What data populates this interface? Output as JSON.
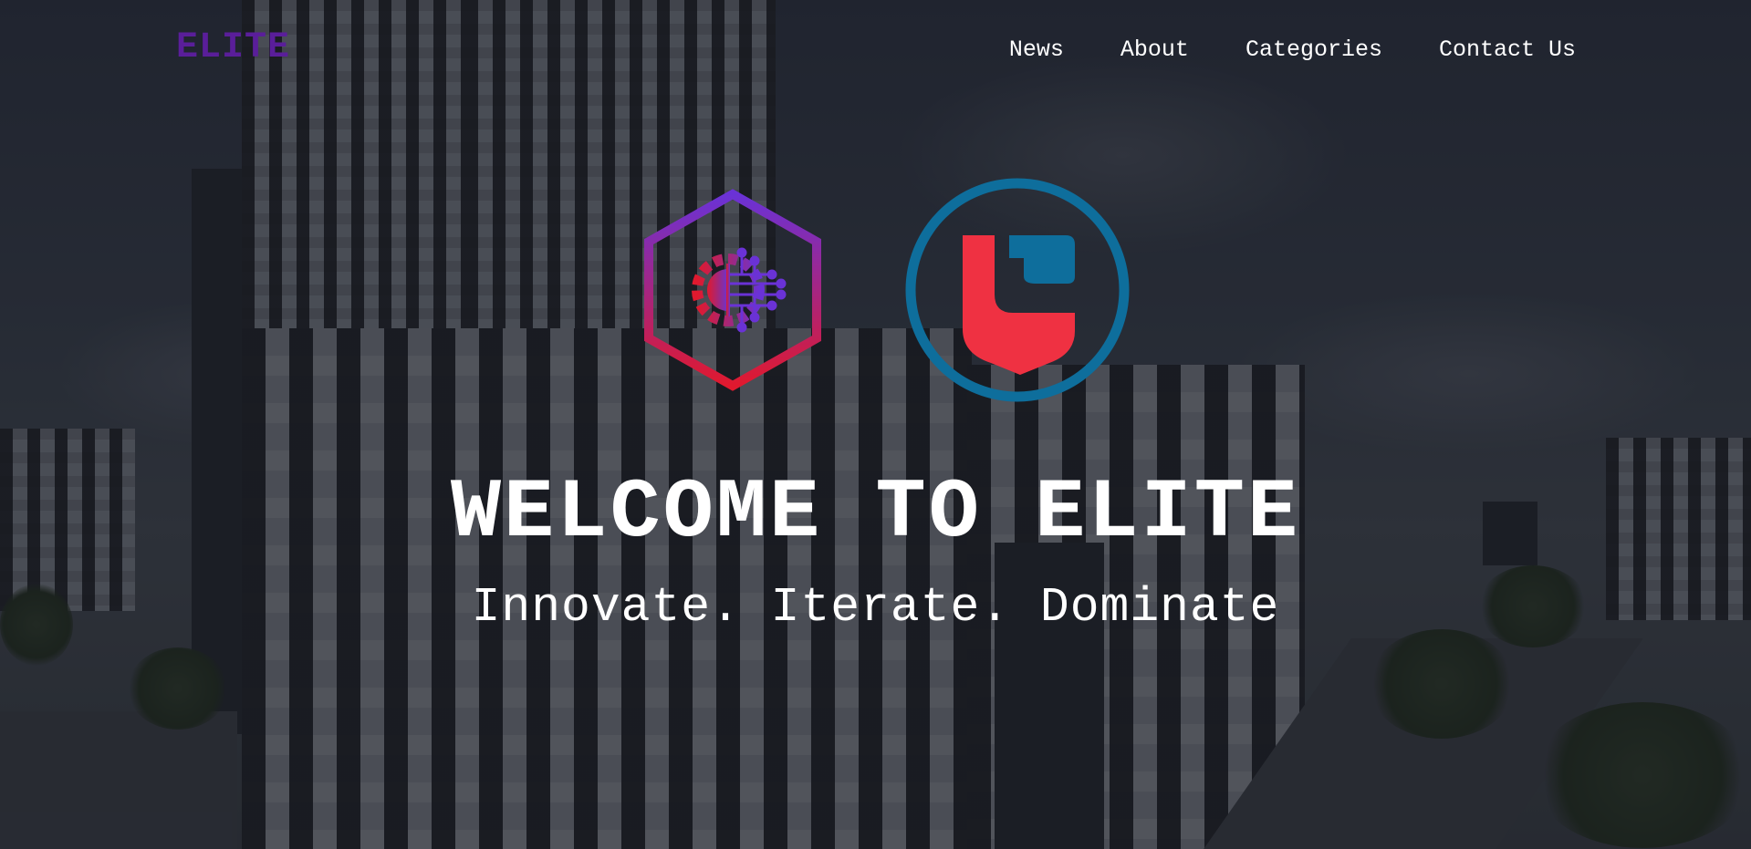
{
  "brand": {
    "name": "ELITE",
    "color": "#5a1e9a"
  },
  "nav": {
    "items": [
      {
        "label": "News"
      },
      {
        "label": "About"
      },
      {
        "label": "Categories"
      },
      {
        "label": "Contact Us"
      }
    ]
  },
  "hero": {
    "background_image": "city-building-photo",
    "logos": [
      {
        "icon": "hexagon-circuit-gear-icon",
        "colors": [
          "#6a32d6",
          "#e0192e"
        ]
      },
      {
        "icon": "circle-shield-icon",
        "colors": [
          "#0e6e9c",
          "#ef3142"
        ]
      }
    ],
    "title": "WELCOME TO ELITE",
    "tagline": "Innovate. Iterate. Dominate"
  }
}
